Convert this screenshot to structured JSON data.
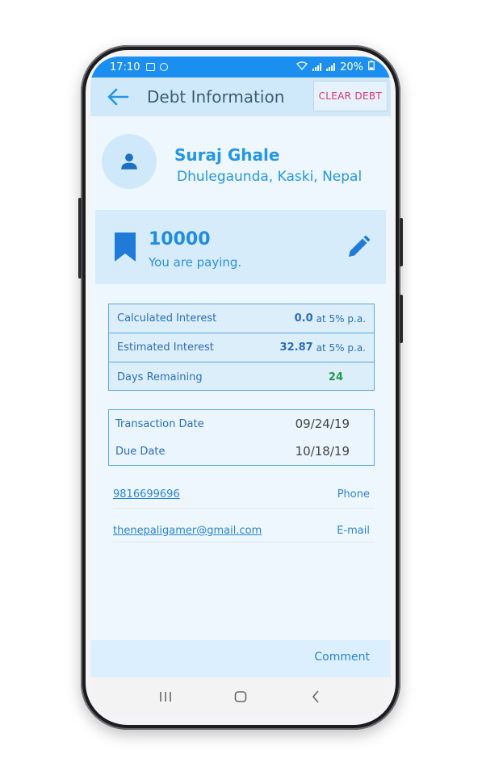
{
  "status_bar": {
    "time": "17:10",
    "battery": "20%"
  },
  "app_bar": {
    "title": "Debt Information",
    "clear_label": "CLEAR DEBT"
  },
  "profile": {
    "name": "Suraj Ghale",
    "address": "Dhulegaunda, Kaski, Nepal"
  },
  "amount": {
    "value": "10000",
    "label": "You are paying."
  },
  "interest": {
    "rows": [
      {
        "label": "Calculated Interest",
        "value": "0.0",
        "suffix": "at 5% p.a."
      },
      {
        "label": "Estimated Interest",
        "value": "32.87",
        "suffix": "at 5% p.a."
      },
      {
        "label": "Days Remaining",
        "value": "24"
      }
    ]
  },
  "dates": {
    "rows": [
      {
        "label": "Transaction Date",
        "value": "09/24/19"
      },
      {
        "label": "Due Date",
        "value": "10/18/19"
      }
    ]
  },
  "contacts": {
    "phone": {
      "value": "9816699696",
      "type": "Phone"
    },
    "email": {
      "value": "thenepaligamer@gmail.com",
      "type": "E-mail"
    }
  },
  "comment": {
    "label": "Comment"
  },
  "icons": {
    "back": "arrow-back-icon",
    "avatar": "person-icon",
    "bookmark": "bookmark-icon",
    "edit": "pencil-icon",
    "nav_recent": "recent-apps-icon",
    "nav_home": "home-icon",
    "nav_back": "back-chevron-icon"
  },
  "colors": {
    "primary": "#2596e6",
    "status_bar": "#1a8ff0",
    "app_bar": "#cfe9fb",
    "clear_debt": "#e0336f",
    "days_remaining": "#1e9a46"
  }
}
